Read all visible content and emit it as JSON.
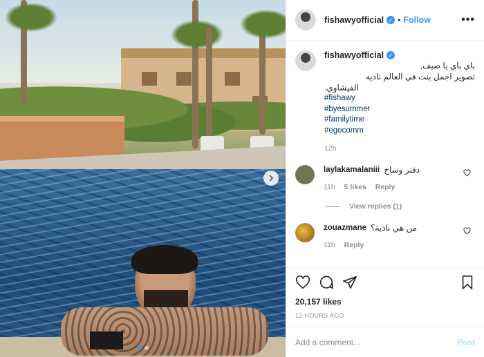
{
  "post": {
    "username": "fishawyofficial",
    "follow_label": "Follow",
    "separator": "•",
    "more_label": "•••",
    "caption": {
      "line1": "باي باي يا صيف,",
      "line2": "تصوير اجمل بنت في العالم ناديه",
      "line3": "الفيشاوي.",
      "hashtags": [
        "#fishawy",
        "#byesummer",
        "#familytime",
        "#egocomm"
      ],
      "time": "12h"
    },
    "comments": [
      {
        "username": "laylakamalaniii",
        "text": "دفتر وساخ",
        "time": "11h",
        "likes": "5 likes",
        "reply_label": "Reply",
        "view_replies": "View replies (1)",
        "avatar_color": "#6b7a52"
      },
      {
        "username": "zouazmane",
        "text": "من هي نادية؟",
        "time": "11h",
        "reply_label": "Reply",
        "avatar_color": "#c79a2e"
      }
    ],
    "likes_count": "20,157 likes",
    "posted_ago": "12 HOURS AGO",
    "add_comment_placeholder": "Add a comment...",
    "post_button": "Post",
    "accent_color": "#3897f0",
    "carousel": {
      "slides": 2,
      "active_index": 0
    }
  }
}
